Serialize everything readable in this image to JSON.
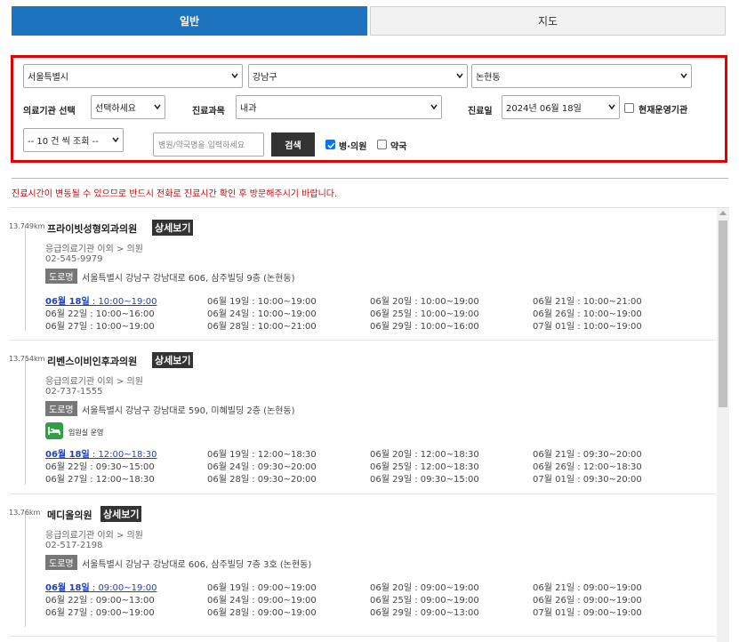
{
  "tabs": [
    {
      "label": "일반"
    },
    {
      "label": "지도"
    }
  ],
  "filters": {
    "sido": "서울특별시",
    "sigungu": "강남구",
    "dong": "논현동",
    "org_label": "의료기관 선택",
    "org_value": "선택하세요",
    "dept_label": "진료과목",
    "dept_value": "내과",
    "date_label": "진료일",
    "date_value": "2024년 06월 18일",
    "open_label": "현재운영기관",
    "count_value": "-- 10 건 씩 조회 --",
    "search_placeholder": "병원/약국명을 입력하세요",
    "search_button": "검색",
    "hospital_label": "병·의원",
    "pharmacy_label": "약국"
  },
  "notice": "진료시간이 변동될 수 있으므로 반드시 전화로 진료시간 확인 후 방문해주시기 바랍니다.",
  "detail_label": "상세보기",
  "road_label": "도로명",
  "items": [
    {
      "distance": "13.749km",
      "name": "프라이빗성형외과의원",
      "category": "응급의료기관 이외 > 의원",
      "phone": "02-545-9979",
      "address": "서울특별시 강남구 강남대로 606, 삼주빌딩 9층 (논현동)",
      "er": "",
      "schedule": [
        [
          "06월 18일",
          " : 10:00~19:00"
        ],
        [
          "06월 19일 : 10:00~19:00"
        ],
        [
          "06월 20일 : 10:00~19:00"
        ],
        [
          "06월 21일 : 10:00~21:00"
        ],
        [
          "06월 22일 : 10:00~16:00"
        ],
        [
          "06월 24일 : 10:00~19:00"
        ],
        [
          "06월 25일 : 10:00~19:00"
        ],
        [
          "06월 26일 : 10:00~19:00"
        ],
        [
          "06월 27일 : 10:00~19:00"
        ],
        [
          "06월 28일 : 10:00~21:00"
        ],
        [
          "06월 29일 : 10:00~16:00"
        ],
        [
          "07월 01일 : 10:00~19:00"
        ]
      ]
    },
    {
      "distance": "13.754km",
      "name": "리벤스이비인후과의원",
      "category": "응급의료기관 이외 > 의원",
      "phone": "02-737-1555",
      "address": "서울특별시 강남구 강남대로 590, 미혜빌딩 2층 (논현동)",
      "er": "입원실 운영",
      "schedule": [
        [
          "06월 18일",
          " : 12:00~18:30"
        ],
        [
          "06월 19일 : 12:00~18:30"
        ],
        [
          "06월 20일 : 12:00~18:30"
        ],
        [
          "06월 21일 : 09:30~20:00"
        ],
        [
          "06월 22일 : 09:30~15:00"
        ],
        [
          "06월 24일 : 09:30~20:00"
        ],
        [
          "06월 25일 : 12:00~18:30"
        ],
        [
          "06월 26일 : 12:00~18:30"
        ],
        [
          "06월 27일 : 12:00~18:30"
        ],
        [
          "06월 28일 : 09:30~20:00"
        ],
        [
          "06월 29일 : 09:30~15:00"
        ],
        [
          "07월 01일 : 09:30~20:00"
        ]
      ]
    },
    {
      "distance": "13.76km",
      "name": "메디올의원",
      "category": "응급의료기관 이외 > 의원",
      "phone": "02-517-2198",
      "address": "서울특별시 강남구 강남대로 606, 삼주빌딩 7층 3호 (논현동)",
      "er": "",
      "schedule": [
        [
          "06월 18일",
          " : 09:00~19:00"
        ],
        [
          "06월 19일 : 09:00~19:00"
        ],
        [
          "06월 20일 : 09:00~19:00"
        ],
        [
          "06월 21일 : 09:00~19:00"
        ],
        [
          "06월 22일 : 09:00~13:00"
        ],
        [
          "06월 24일 : 09:00~19:00"
        ],
        [
          "06월 25일 : 09:00~19:00"
        ],
        [
          "06월 26일 : 09:00~19:00"
        ],
        [
          "06월 27일 : 09:00~19:00"
        ],
        [
          "06월 28일 : 09:00~19:00"
        ],
        [
          "06월 29일 : 09:00~13:00"
        ],
        [
          "07월 01일 : 09:00~19:00"
        ]
      ]
    }
  ]
}
